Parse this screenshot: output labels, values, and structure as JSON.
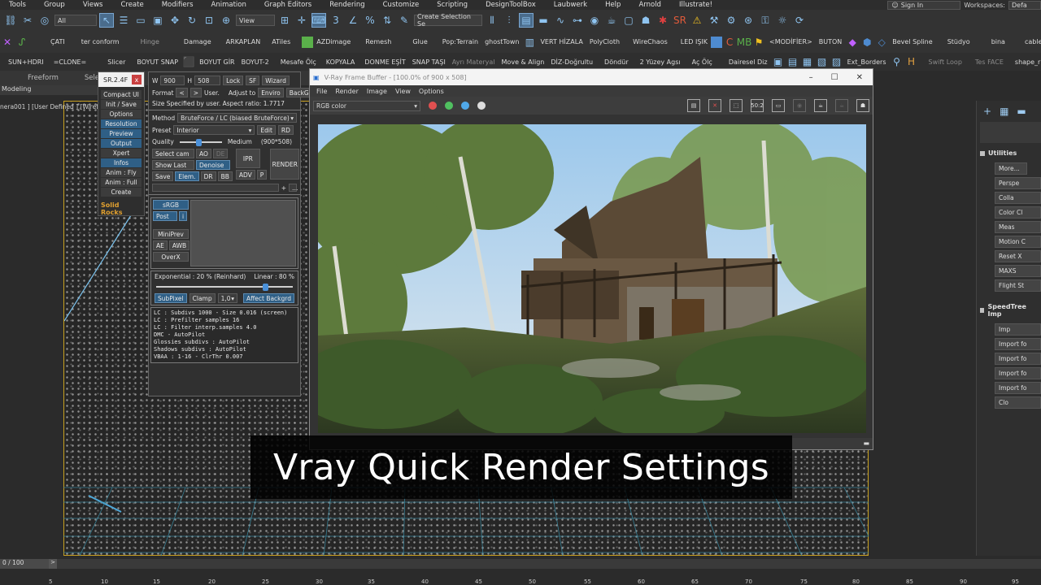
{
  "menubar": {
    "items": [
      "Tools",
      "Group",
      "Views",
      "Create",
      "Modifiers",
      "Animation",
      "Graph Editors",
      "Rendering",
      "Customize",
      "Scripting",
      "DesignToolBox",
      "Laubwerk",
      "Help",
      "Arnold",
      "Illustrate!"
    ],
    "sign_in": "Sign In",
    "workspaces_label": "Workspaces:",
    "workspaces_value": "Defa"
  },
  "toolbar1": {
    "filter": "All",
    "view": "View",
    "selection_set": "Create Selection Se"
  },
  "toolbar2": {
    "labels": [
      "ÇATI",
      "ter conform",
      "Hinge",
      "Damage",
      "ARKAPLAN",
      "ATiles",
      "AZDimage",
      "Remesh",
      "Glue",
      "Pop:Terrain",
      "ghostTown",
      "VERT HİZALA",
      "PolyCloth",
      "WireChaos",
      "LED IŞIK",
      "Bevel Spline",
      "Stüdyo",
      "bina",
      "cables"
    ],
    "modifier_label": "<MODİFİER>",
    "buton_label": "BUTON"
  },
  "toolbar3": {
    "labels": [
      "SUN+HDRI",
      "=CLONE=",
      "Slicer",
      "BOYUT SNAP",
      "BOYUT GİR",
      "BOYUT-2",
      "Mesafe Ölç",
      "KOPYALA",
      "DONME EŞİT",
      "SNAP TAŞI",
      "Ayrı Materyal",
      "Move & Align",
      "DİZ-Doğrultu",
      "Döndür",
      "2 Yüzey Agsı",
      "Aç Ölç",
      "Dairesel Diz",
      "Ext_Borders",
      "Swift Loop",
      "Tes FACE",
      "shape_r"
    ]
  },
  "ribbon": {
    "tabs": [
      "Freeform",
      "Sele"
    ],
    "modeling": "Modeling"
  },
  "viewport": {
    "label": "nera001 ] [User Defined ] [Wirefr"
  },
  "sr_panel": {
    "title": "SR.2.4F",
    "close": "x",
    "buttons": [
      "Compact UI",
      "Init / Save",
      "Options",
      "Resolution",
      "Preview",
      "Output",
      "Xpert",
      "Infos",
      "Anim : Fly",
      "Anim : Full",
      "Create"
    ],
    "logo": "Solid Rocks"
  },
  "render_settings": {
    "w_label": "W",
    "w_value": "900",
    "h_label": "H",
    "h_value": "508",
    "lock": "Lock",
    "sf": "SF",
    "wizard": "Wizard",
    "format_label": "Format",
    "format_value": "User.",
    "adjust_label": "Adjust to",
    "enviro": "Enviro",
    "backg": "BackG",
    "size_text": "Size  Specified by user. Aspect ratio: 1.7717",
    "method_label": "Method",
    "method_value": "BruteForce / LC (biased BruteForce)",
    "preset_label": "Preset",
    "preset_value": "Interior",
    "edit": "Edit",
    "rd": "RD",
    "quality_label": "Quality",
    "quality_value": "Medium",
    "quality_res": "(900*508)",
    "quality_level": 0.45,
    "select_cam": "Select cam",
    "ao": "AO",
    "de": "DE",
    "ipr": "IPR",
    "show_last": "Show Last",
    "denoise": "Denoise",
    "render": "RENDER",
    "save": "Save",
    "elem": "Elem.",
    "dr": "DR",
    "bb": "BB",
    "adv": "ADV",
    "p": "P",
    "srgb": "sRGB",
    "post": "Post",
    "i": "i",
    "miniprev": "MiniPrev",
    "ae": "AE",
    "awb": "AWB",
    "overx": "OverX",
    "exposure_left": "Exponential : 20 %  (Reinhard)",
    "exposure_right": "Linear : 80 %",
    "exposure_level": 0.8,
    "subpixel": "SubPixel",
    "clamp": "Clamp",
    "clamp_value": "1,0",
    "affect_backgrd": "Affect Backgrd",
    "info_lines": [
      "LC : Subdivs 1000 - Size 0.016 (screen)",
      "LC : Prefilter samples 16",
      "LC : Filter interp.samples  4.0",
      "DMC - AutoPilot",
      "Glossies subdivs : AutoPilot",
      "Shadows subdivs : AutoPilot",
      "VBAA : 1-16 - ClrThr 0.007"
    ]
  },
  "frame_buffer": {
    "title": "V-Ray Frame Buffer - [100.0% of 900 x 508]",
    "menu": [
      "File",
      "Render",
      "Image",
      "View",
      "Options"
    ],
    "channel": "RGB color",
    "ratio_icon": "50:2"
  },
  "command_panel": {
    "utilities_title": "Utilities",
    "utilities_buttons": [
      "More...",
      "Perspe",
      "Colla",
      "Color Cl",
      "Meas",
      "Motion C",
      "Reset X",
      "MAXS",
      "Flight St"
    ],
    "speedtree_title": "SpeedTree Imp",
    "speedtree_buttons": [
      "Imp",
      "Import fo",
      "Import fo",
      "Import fo",
      "Import fo",
      "Clo"
    ]
  },
  "caption": "Vray Quick Render Settings",
  "timeline": {
    "position": "0 / 100",
    "arrow": ">",
    "ticks": [
      "5",
      "10",
      "15",
      "20",
      "25",
      "30",
      "35",
      "40",
      "45",
      "50",
      "55",
      "60",
      "65",
      "70",
      "75",
      "80",
      "85",
      "90",
      "95"
    ]
  },
  "colors": {
    "accent_blue": "#2f5f86",
    "viewport_border": "#c8a020",
    "close_red": "#c94040"
  }
}
